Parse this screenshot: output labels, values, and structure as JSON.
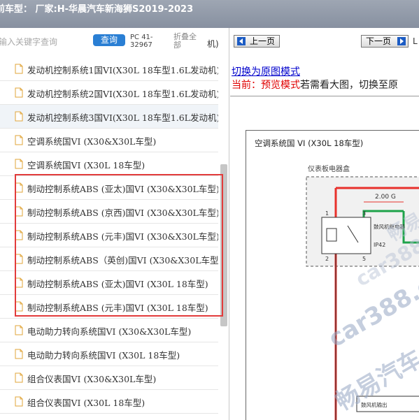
{
  "header": {
    "title": "前车型：  厂家:H-华晨汽车新海狮S2019-2023"
  },
  "search": {
    "placeholder": "输入关键字查询",
    "query_label": "查询",
    "pc_code": "PC 41-32967",
    "collapse_label": "折叠全部",
    "partial_right": "机)"
  },
  "list": {
    "items": [
      {
        "label": "发动机控制系统1国VI(X30L 18车型1.6L发动机)"
      },
      {
        "label": "发动机控制系统2国VI(X30L 18车型1.6L发动机)"
      },
      {
        "label": "发动机控制系统3国VI(X30L 18车型1.6L发动机)"
      },
      {
        "label": "空调系统国VI (X30&X30L车型)"
      },
      {
        "label": "空调系统国VI (X30L 18车型)"
      },
      {
        "label": "制动控制系统ABS (亚太)国VI (X30&X30L车型)"
      },
      {
        "label": "制动控制系统ABS (京西)国VI (X30&X30L车型)"
      },
      {
        "label": "制动控制系统ABS (元丰)国VI (X30&X30L车型)"
      },
      {
        "label": "制动控制系统ABS（英创)国VI (X30&X30L车型)"
      },
      {
        "label": "制动控制系统ABS (亚太)国VI (X30L 18车型)"
      },
      {
        "label": "制动控制系统ABS (元丰)国VI (X30L 18车型)"
      },
      {
        "label": "电动助力转向系统国VI (X30&X30L车型)"
      },
      {
        "label": "电动助力转向系统国VI (X30L 18车型)"
      },
      {
        "label": "组合仪表国VI (X30&X30L车型)"
      },
      {
        "label": "组合仪表国VI (X30L 18车型)"
      }
    ]
  },
  "viewer": {
    "prev_label": "上一页",
    "next_label": "下一页",
    "partial_right": "L",
    "switch_link": "切换为原图模式",
    "mode_current": "当前：预览模式",
    "mode_hint": "若需看大图，切换至原",
    "diagram": {
      "title": "空调系统国 VI (X30L 18车型)",
      "box_label": "仪表板电器盒",
      "wire_label": "2.00 G",
      "relay_label": "鼓风机继电器",
      "relay_code": "IP42",
      "pin1": "1",
      "pin2": "2",
      "pin3": "3",
      "pin5": "5",
      "bottom_label": "鼓风机输出"
    },
    "watermarks": [
      "畅易",
      "car388.c",
      "car388.c",
      "畅易汽车"
    ]
  },
  "colors": {
    "accent": "#2a7fd4",
    "highlight": "#e23b3b",
    "link": "#0000cc",
    "wire_red": "#e8312c",
    "wire_green": "#1ea34a"
  }
}
